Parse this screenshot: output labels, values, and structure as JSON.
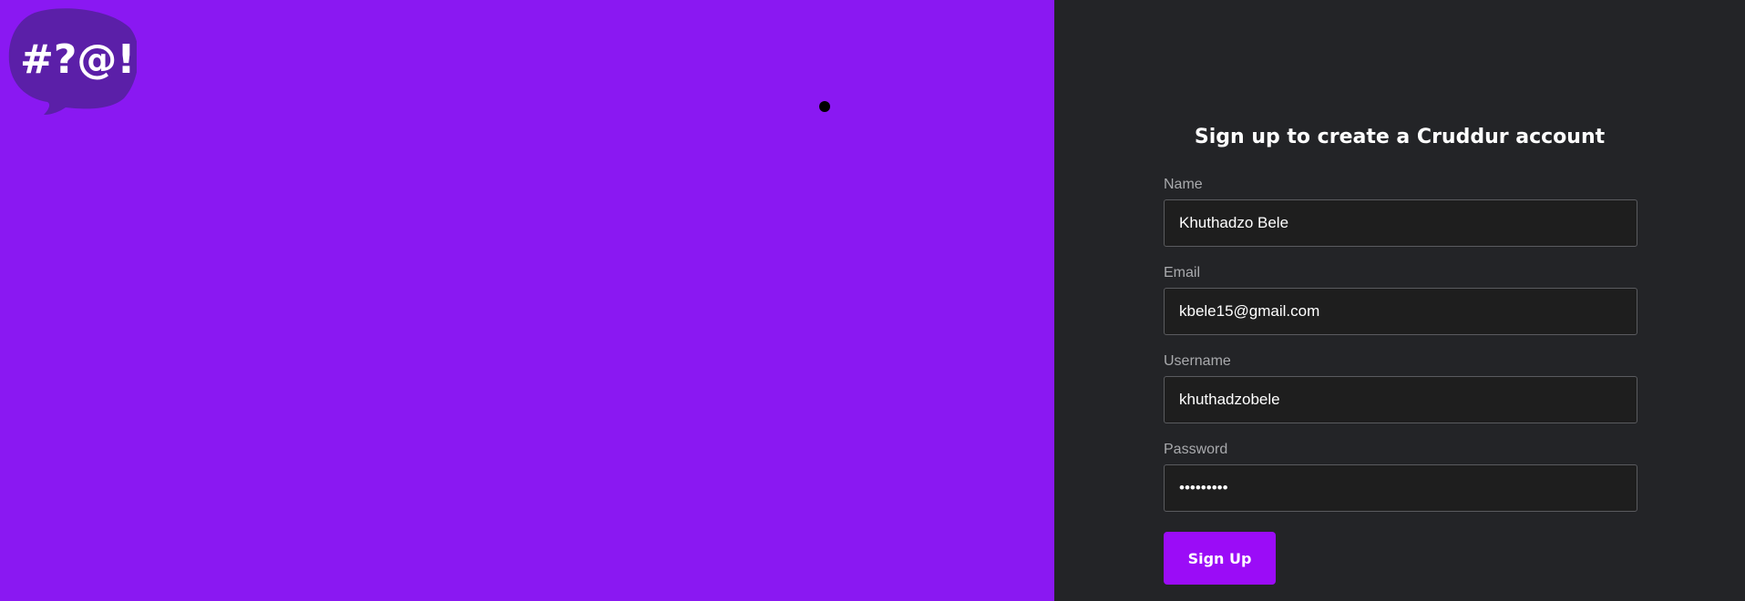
{
  "logo": {
    "text": "#?@!",
    "icon": "speech-bubble-logo-icon"
  },
  "signup_form": {
    "title": "Sign up to create a Cruddur account",
    "fields": {
      "name": {
        "label": "Name",
        "value": "Khuthadzo Bele"
      },
      "email": {
        "label": "Email",
        "value": "kbele15@gmail.com"
      },
      "username": {
        "label": "Username",
        "value": "khuthadzobele"
      },
      "password": {
        "label": "Password",
        "value": "•••••••••"
      }
    },
    "submit_label": "Sign Up"
  },
  "colors": {
    "left_panel_bg": "#8a18f2",
    "right_panel_bg": "#232427",
    "input_bg": "#1e1e1e",
    "button_bg": "#9b0cf7"
  }
}
